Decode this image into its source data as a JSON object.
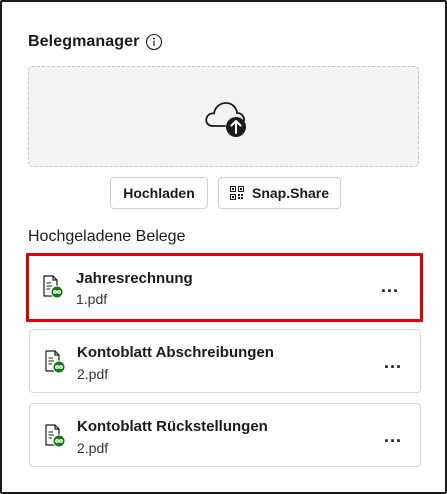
{
  "header": {
    "title": "Belegmanager",
    "info_icon": "info-icon"
  },
  "dropzone": {
    "icon": "cloud-upload-icon"
  },
  "buttons": {
    "upload_label": "Hochladen",
    "snap_label": "Snap.Share",
    "snap_icon": "qr-code-icon"
  },
  "section": {
    "title": "Hochgeladene Belege"
  },
  "documents": [
    {
      "title": "Jahresrechnung",
      "file": "1.pdf",
      "selected": true,
      "icon": "linked-document-icon",
      "menu": "..."
    },
    {
      "title": "Kontoblatt Abschreibungen",
      "file": "2.pdf",
      "selected": false,
      "icon": "linked-document-icon",
      "menu": "..."
    },
    {
      "title": "Kontoblatt Rückstellungen",
      "file": "2.pdf",
      "selected": false,
      "icon": "linked-document-icon",
      "menu": "..."
    }
  ],
  "colors": {
    "selection_border": "#e00000",
    "link_badge": "#107c10",
    "text": "#1b1b1b",
    "dropzone_bg": "#f3f3f3"
  }
}
